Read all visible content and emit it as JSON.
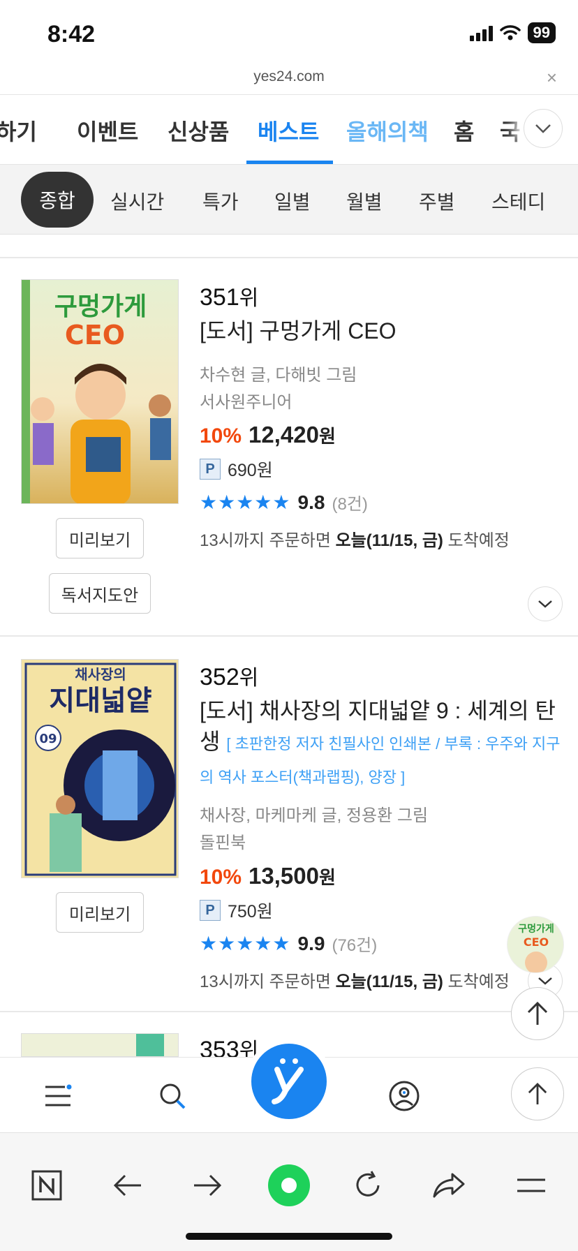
{
  "status_bar": {
    "time": "8:42",
    "battery": "99"
  },
  "browser": {
    "url": "yes24.com",
    "close_label": "×"
  },
  "main_tabs": [
    {
      "label": "하기"
    },
    {
      "label": "이벤트"
    },
    {
      "label": "신상품"
    },
    {
      "label": "베스트",
      "active": true
    },
    {
      "label": "올해의책"
    },
    {
      "label": "홈"
    },
    {
      "label": "국"
    }
  ],
  "filters": [
    {
      "label": "종합",
      "active": true
    },
    {
      "label": "실시간"
    },
    {
      "label": "특가"
    },
    {
      "label": "일별"
    },
    {
      "label": "월별"
    },
    {
      "label": "주별"
    },
    {
      "label": "스테디"
    }
  ],
  "books": [
    {
      "rank_num": "351",
      "rank_suffix": "위",
      "title": "[도서] 구멍가게 CEO",
      "promo": "",
      "author": "차수현 글, 다해빗 그림",
      "publisher": "서사원주니어",
      "discount": "10%",
      "price": "12,420",
      "currency": "원",
      "point_badge": "P",
      "points": "690원",
      "stars": "★★★★★",
      "score": "9.8",
      "review_count": "(8건)",
      "delivery_prefix": "13시까지 주문하면 ",
      "delivery_date": "오늘(11/15, 금)",
      "delivery_suffix": " 도착예정",
      "preview_label": "미리보기",
      "guide_label": "독서지도안",
      "cover_title": "구멍가게",
      "cover_subtitle": "CEO"
    },
    {
      "rank_num": "352",
      "rank_suffix": "위",
      "title": "[도서] 채사장의 지대넓얕 9 : 세계의 탄생",
      "promo": "[ 초판한정 저자 친필사인 인쇄본 / 부록 : 우주와 지구의 역사 포스터(책과랩핑), 양장 ]",
      "author": "채사장, 마케마케 글, 정용환 그림",
      "publisher": "돌핀북",
      "discount": "10%",
      "price": "13,500",
      "currency": "원",
      "point_badge": "P",
      "points": "750원",
      "stars": "★★★★★",
      "score": "9.9",
      "review_count": "(76건)",
      "delivery_prefix": "13시까지 주문하면 ",
      "delivery_date": "오늘(11/15, 금)",
      "delivery_suffix": " 도착예정",
      "preview_label": "미리보기",
      "cover_top": "채사장의",
      "cover_title": "지대넓얕",
      "cover_volume": "09"
    },
    {
      "rank_num": "353",
      "rank_suffix": "위"
    }
  ],
  "float_thumb": {
    "title": "구멍가게",
    "subtitle": "CEO"
  },
  "colors": {
    "accent": "#1a84f0",
    "discount": "#f2480d",
    "promo": "#3ea0f5"
  },
  "icons": [
    "menu-icon",
    "search-icon",
    "yes24-logo-icon",
    "my-page-icon",
    "arrow-up-icon",
    "naver-n-icon",
    "back-arrow-icon",
    "forward-arrow-icon",
    "green-dot-icon",
    "reload-icon",
    "share-icon",
    "hamburger-icon"
  ]
}
